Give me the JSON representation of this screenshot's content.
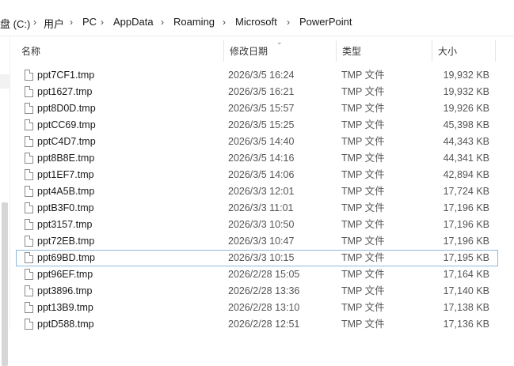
{
  "breadcrumb": {
    "items": [
      "盘 (C:)",
      "用户",
      "PC",
      "AppData",
      "Roaming",
      "Microsoft",
      "PowerPoint"
    ],
    "separator": "›"
  },
  "columns": {
    "name": "名称",
    "date": "修改日期",
    "type": "类型",
    "size": "大小"
  },
  "files": [
    {
      "name": "ppt7CF1.tmp",
      "date": "2026/3/5 16:24",
      "type": "TMP 文件",
      "size": "19,932 KB"
    },
    {
      "name": "ppt1627.tmp",
      "date": "2026/3/5 16:21",
      "type": "TMP 文件",
      "size": "19,932 KB"
    },
    {
      "name": "ppt8D0D.tmp",
      "date": "2026/3/5 15:57",
      "type": "TMP 文件",
      "size": "19,926 KB"
    },
    {
      "name": "pptCC69.tmp",
      "date": "2026/3/5 15:25",
      "type": "TMP 文件",
      "size": "45,398 KB"
    },
    {
      "name": "pptC4D7.tmp",
      "date": "2026/3/5 14:40",
      "type": "TMP 文件",
      "size": "44,343 KB"
    },
    {
      "name": "ppt8B8E.tmp",
      "date": "2026/3/5 14:16",
      "type": "TMP 文件",
      "size": "44,341 KB"
    },
    {
      "name": "ppt1EF7.tmp",
      "date": "2026/3/5 14:06",
      "type": "TMP 文件",
      "size": "42,894 KB"
    },
    {
      "name": "ppt4A5B.tmp",
      "date": "2026/3/3 12:01",
      "type": "TMP 文件",
      "size": "17,724 KB"
    },
    {
      "name": "pptB3F0.tmp",
      "date": "2026/3/3 11:01",
      "type": "TMP 文件",
      "size": "17,196 KB"
    },
    {
      "name": "ppt3157.tmp",
      "date": "2026/3/3 10:50",
      "type": "TMP 文件",
      "size": "17,196 KB"
    },
    {
      "name": "ppt72EB.tmp",
      "date": "2026/3/3 10:47",
      "type": "TMP 文件",
      "size": "17,196 KB"
    },
    {
      "name": "ppt69BD.tmp",
      "date": "2026/3/3 10:15",
      "type": "TMP 文件",
      "size": "17,195 KB",
      "selected": true
    },
    {
      "name": "ppt96EF.tmp",
      "date": "2026/2/28 15:05",
      "type": "TMP 文件",
      "size": "17,164 KB"
    },
    {
      "name": "ppt3896.tmp",
      "date": "2026/2/28 13:36",
      "type": "TMP 文件",
      "size": "17,140 KB"
    },
    {
      "name": "ppt13B9.tmp",
      "date": "2026/2/28 13:10",
      "type": "TMP 文件",
      "size": "17,138 KB"
    },
    {
      "name": "pptD588.tmp",
      "date": "2026/2/28 12:51",
      "type": "TMP 文件",
      "size": "17,136 KB"
    }
  ],
  "icons": {
    "file": "file-icon",
    "sort": "sort-chevron-icon"
  }
}
